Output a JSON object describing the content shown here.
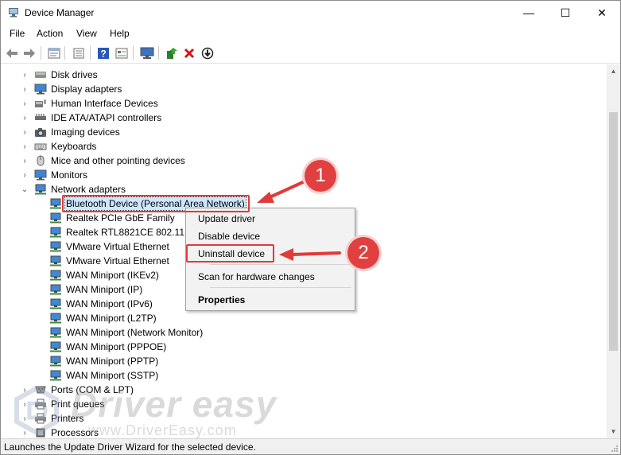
{
  "window": {
    "title": "Device Manager",
    "controls": {
      "minimize": "—",
      "maximize": "☐",
      "close": "✕"
    }
  },
  "menu": [
    "File",
    "Action",
    "View",
    "Help"
  ],
  "toolbar": {
    "icons": [
      "back-icon",
      "forward-icon",
      "properties-icon",
      "list-icon",
      "help-icon",
      "view-icon",
      "monitor-icon",
      "update-driver-icon",
      "uninstall-icon",
      "download-icon"
    ]
  },
  "tree": {
    "categories": [
      {
        "label": "Disk drives",
        "icon": "disk-icon"
      },
      {
        "label": "Display adapters",
        "icon": "display-icon"
      },
      {
        "label": "Human Interface Devices",
        "icon": "hid-icon"
      },
      {
        "label": "IDE ATA/ATAPI controllers",
        "icon": "ide-icon"
      },
      {
        "label": "Imaging devices",
        "icon": "camera-icon"
      },
      {
        "label": "Keyboards",
        "icon": "keyboard-icon"
      },
      {
        "label": "Mice and other pointing devices",
        "icon": "mouse-icon"
      },
      {
        "label": "Monitors",
        "icon": "monitor-icon"
      },
      {
        "label": "Network adapters",
        "icon": "network-icon",
        "expanded": true
      }
    ],
    "network_children": [
      "Bluetooth Device (Personal Area Network)",
      "Realtek PCIe GbE Family",
      "Realtek RTL8821CE 802.11",
      "VMware Virtual Ethernet",
      "VMware Virtual Ethernet",
      "WAN Miniport (IKEv2)",
      "WAN Miniport (IP)",
      "WAN Miniport (IPv6)",
      "WAN Miniport (L2TP)",
      "WAN Miniport (Network Monitor)",
      "WAN Miniport (PPPOE)",
      "WAN Miniport (PPTP)",
      "WAN Miniport (SSTP)"
    ],
    "after": [
      {
        "label": "Ports (COM & LPT)",
        "icon": "port-icon"
      },
      {
        "label": "Print queues",
        "icon": "printer-icon"
      },
      {
        "label": "Printers",
        "icon": "printer-icon"
      },
      {
        "label": "Processors",
        "icon": "cpu-icon"
      }
    ],
    "selected": "Bluetooth Device (Personal Area Network)"
  },
  "context_menu": {
    "items": [
      "Update driver",
      "Disable device",
      "Uninstall device",
      "Scan for hardware changes",
      "Properties"
    ]
  },
  "annotations": {
    "badge1": "1",
    "badge2": "2",
    "color": "#e14040"
  },
  "status": "Launches the Update Driver Wizard for the selected device.",
  "watermark": {
    "brand": "Driver easy",
    "url": "www.DriverEasy.com"
  }
}
